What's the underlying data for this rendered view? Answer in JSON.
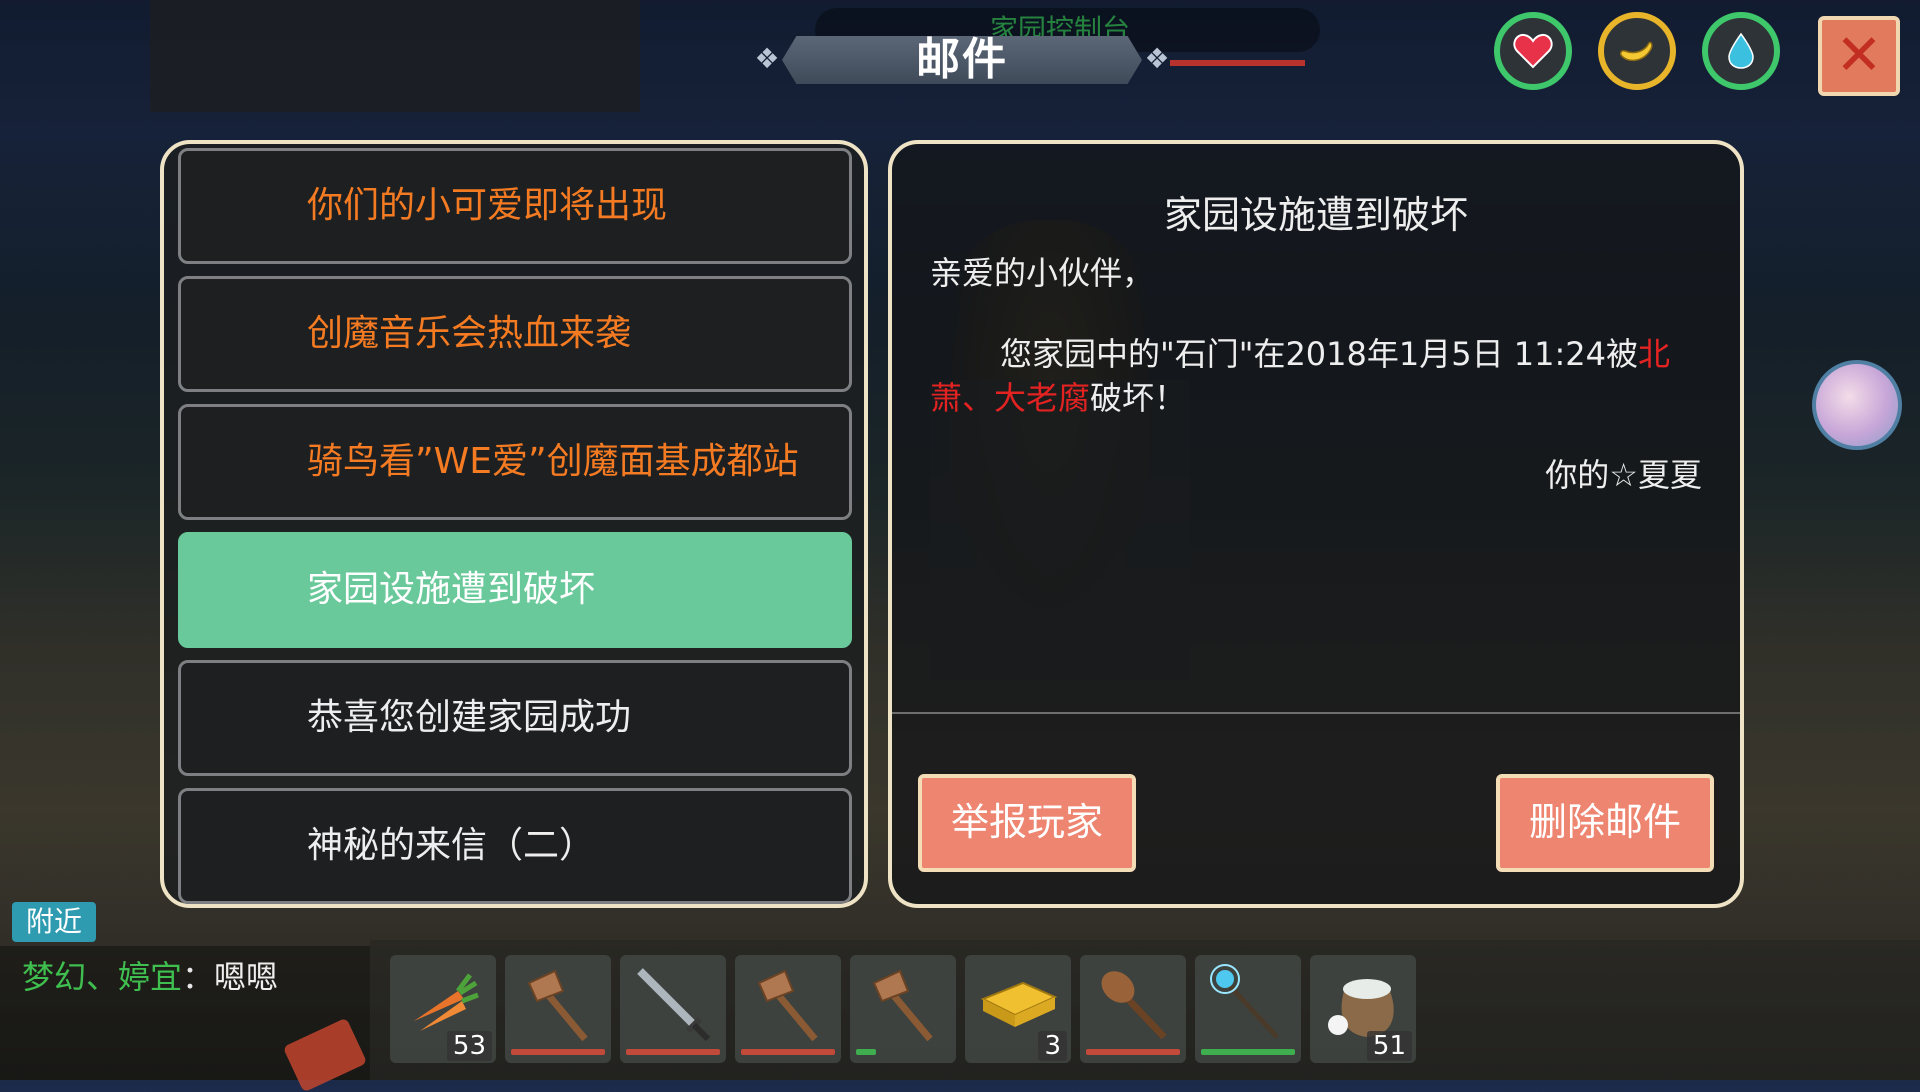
{
  "window": {
    "title": "邮件",
    "background_label": "家园控制台"
  },
  "stats": {
    "heart": {
      "icon": "heart-icon",
      "color": "#3ec86b"
    },
    "food": {
      "icon": "banana-icon",
      "color": "#e8b42a"
    },
    "water": {
      "icon": "water-drop-icon",
      "color": "#3ec86b"
    }
  },
  "mail_list": [
    {
      "subject": "你们的小可爱即将出现",
      "style": "orange"
    },
    {
      "subject": "创魔音乐会热血来袭",
      "style": "orange"
    },
    {
      "subject": "骑鸟看”WE爱”创魔面基成都站",
      "style": "orange"
    },
    {
      "subject": "家园设施遭到破坏",
      "style": "selected"
    },
    {
      "subject": "恭喜您创建家园成功",
      "style": "white"
    },
    {
      "subject": "神秘的来信（二）",
      "style": "white"
    }
  ],
  "mail_detail": {
    "title": "家园设施遭到破坏",
    "greeting": "亲爱的小伙伴，",
    "body_prefix": "您家园中的\"石门\"在2018年1月5日 11:24被",
    "body_highlight": "北萧、大老腐",
    "body_suffix": "破坏！",
    "signature": "你的☆夏夏",
    "report_button": "举报玩家",
    "delete_button": "删除邮件"
  },
  "chat": {
    "channel": "附近",
    "name": "梦幻、婷宜",
    "colon": "：",
    "message": "嗯嗯"
  },
  "hotbar": [
    {
      "item": "carrot-icon",
      "count": "53"
    },
    {
      "item": "stone-axe-icon",
      "count": "",
      "durability": 1.0,
      "dur_color": "#c24a3a"
    },
    {
      "item": "sword-icon",
      "count": "",
      "durability": 1.0,
      "dur_color": "#c24a3a"
    },
    {
      "item": "stone-axe-icon",
      "count": "",
      "durability": 1.0,
      "dur_color": "#c24a3a"
    },
    {
      "item": "stone-axe-icon",
      "count": "",
      "durability": 0.2,
      "dur_color": "#3fae4f"
    },
    {
      "item": "honeycomb-icon",
      "count": "3"
    },
    {
      "item": "club-icon",
      "count": "",
      "durability": 1.0,
      "dur_color": "#c24a3a"
    },
    {
      "item": "magic-staff-icon",
      "count": "",
      "durability": 1.0,
      "dur_color": "#3fae4f"
    },
    {
      "item": "cotton-sack-icon",
      "count": "51"
    }
  ]
}
